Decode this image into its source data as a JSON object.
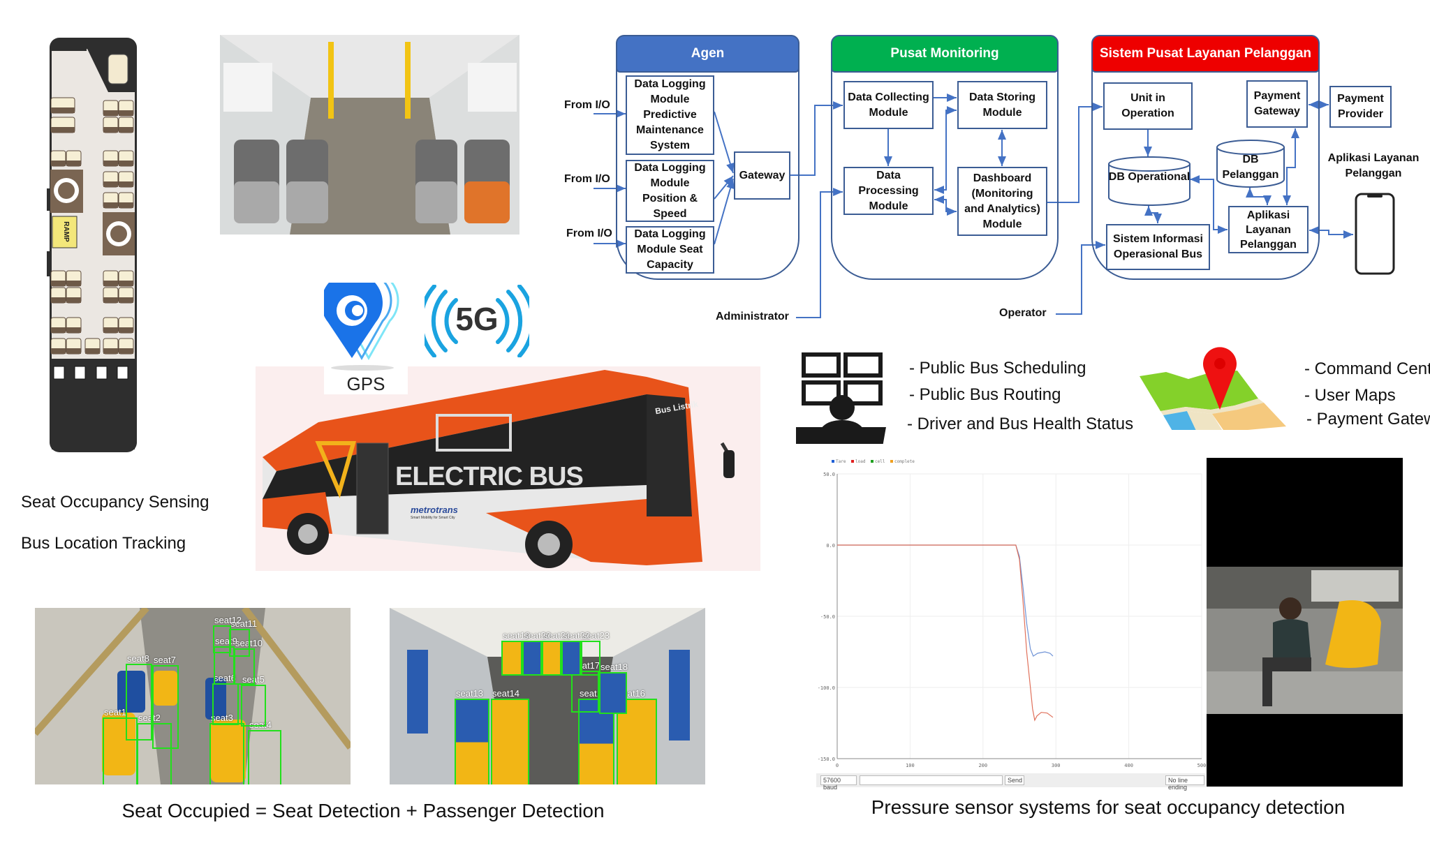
{
  "seat_plan": {
    "ramp_label": "RAMP"
  },
  "captions": {
    "seat_sensing": "Seat Occupancy Sensing",
    "location_tracking": "Bus Location Tracking",
    "seat_occupied": "Seat Occupied = Seat Detection + Passenger Detection",
    "pressure_sensor": "Pressure sensor systems for seat occupancy detection"
  },
  "icons": {
    "gps_label": "GPS",
    "network_label": "5G",
    "gps_color": "#1a73e8",
    "network_color": "#1aa3e0"
  },
  "bus_photo": {
    "livery_text": "ELECTRIC BUS",
    "operator_text": "metrotrans",
    "destination_text": "Bus Listrik",
    "tagline": "Smart Mobility for Smart City"
  },
  "diagram": {
    "agen": {
      "title": "Agen",
      "color": "#4472c4",
      "inputs": [
        "From I/O",
        "From I/O",
        "From I/O"
      ],
      "modules": [
        "Data Logging Module Predictive Maintenance System",
        "Data Logging Module Position & Speed",
        "Data Logging Module Seat Capacity"
      ],
      "gateway": "Gateway"
    },
    "pusat": {
      "title": "Pusat Monitoring",
      "color": "#00b050",
      "collecting": "Data Collecting Module",
      "storing": "Data Storing Module",
      "processing": "Data Processing Module",
      "dashboard": "Dashboard (Monitoring and Analytics) Module"
    },
    "sistem": {
      "title": "Sistem Pusat Layanan Pelanggan",
      "color": "#ee0000",
      "unit": "Unit in Operation",
      "payment_gateway": "Payment Gateway",
      "db_operational": "DB Operational",
      "db_pelanggan": "DB Pelanggan",
      "aplikasi": "Aplikasi Layanan Pelanggan",
      "siob": "Sistem Informasi Operasional Bus"
    },
    "payment_provider": "Payment Provider",
    "app_label": "Aplikasi Layanan Pelanggan",
    "administrator": "Administrator",
    "operator": "Operator"
  },
  "features_left": [
    "- Public Bus Scheduling",
    "- Public Bus Routing",
    "- Driver and Bus Health Status"
  ],
  "features_right": [
    "- Command Center",
    "- User Maps",
    "- Payment Gateway"
  ],
  "seat_detection": {
    "left_labels": [
      "seat1",
      "seat2",
      "seat3",
      "seat4",
      "seat5",
      "seat6",
      "seat7",
      "seat8",
      "seat9",
      "seat10",
      "seat11",
      "seat12"
    ],
    "right_labels": [
      "seat13",
      "seat14",
      "seat15",
      "seat16",
      "seat17",
      "seat18",
      "seat19",
      "seat20",
      "seat21",
      "seat22",
      "seat23"
    ]
  },
  "serial_plotter": {
    "baud": "57600 baud",
    "send_label": "Send",
    "line_ending": "No line ending"
  },
  "chart_data": {
    "type": "line",
    "title": "",
    "xlabel": "",
    "ylabel": "",
    "xlim": [
      0,
      500
    ],
    "ylim": [
      -150,
      50
    ],
    "x_ticks": [
      "0",
      "100",
      "200",
      "300",
      "400",
      "500"
    ],
    "y_ticks": [
      "50.0",
      "0.0",
      "-50.0",
      "-100.0",
      "-150.0"
    ],
    "grid": true,
    "legend": {
      "placement": "top-left",
      "entries": [
        "Tare",
        "load",
        "cell",
        "complete"
      ],
      "colors": [
        "#1f5fd6",
        "#e02020",
        "#20a020",
        "#f0a020"
      ]
    },
    "series": [
      {
        "name": "Tare",
        "color": "#6f93d6",
        "points": [
          [
            0,
            0
          ],
          [
            245,
            0
          ],
          [
            250,
            -8
          ],
          [
            255,
            -30
          ],
          [
            260,
            -55
          ],
          [
            265,
            -73
          ],
          [
            269,
            -78
          ],
          [
            275,
            -76
          ],
          [
            285,
            -75
          ],
          [
            292,
            -76
          ],
          [
            296,
            -78
          ]
        ]
      },
      {
        "name": "load",
        "color": "#e0705a",
        "points": [
          [
            0,
            0
          ],
          [
            245,
            0
          ],
          [
            250,
            -10
          ],
          [
            255,
            -40
          ],
          [
            260,
            -75
          ],
          [
            265,
            -100
          ],
          [
            268,
            -115
          ],
          [
            271,
            -123
          ],
          [
            274,
            -120
          ],
          [
            280,
            -117.5
          ],
          [
            288,
            -118
          ],
          [
            296,
            -121
          ]
        ]
      }
    ]
  }
}
